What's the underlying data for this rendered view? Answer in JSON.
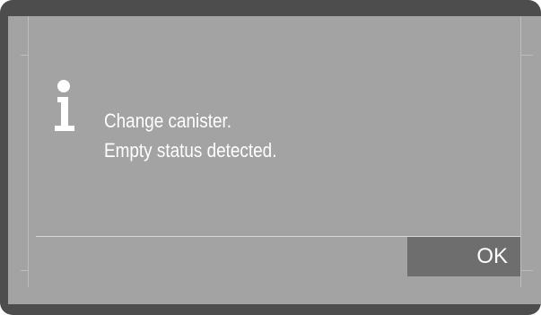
{
  "dialog": {
    "icon": "info-icon",
    "message_lines": [
      "Change canister.",
      "Empty status detected."
    ],
    "ok_label": "OK"
  },
  "colors": {
    "bezel": "#4d4d4d",
    "screen_background": "#a3a3a3",
    "button_background": "#6e6e6e",
    "text": "#ffffff"
  }
}
